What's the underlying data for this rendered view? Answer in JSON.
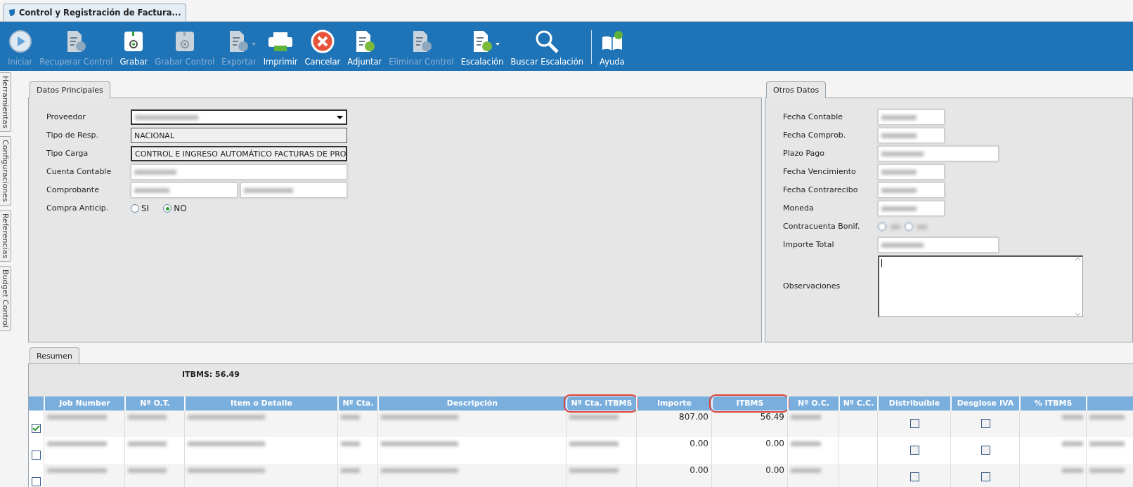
{
  "window": {
    "title": "Control y Registración de Factura..."
  },
  "toolbar": [
    {
      "label": "Iniciar",
      "kind": "play",
      "disabled": true,
      "dropdown": false
    },
    {
      "label": "Recuperar Control",
      "kind": "document",
      "disabled": true,
      "dropdown": false
    },
    {
      "label": "Grabar",
      "kind": "floppy",
      "disabled": false,
      "dropdown": false
    },
    {
      "label": "Grabar Control",
      "kind": "floppy",
      "disabled": true,
      "dropdown": false
    },
    {
      "label": "Exportar",
      "kind": "document",
      "disabled": true,
      "dropdown": true
    },
    {
      "label": "Imprimir",
      "kind": "printer",
      "disabled": false,
      "dropdown": false
    },
    {
      "label": "Cancelar",
      "kind": "cancel",
      "disabled": false,
      "dropdown": false
    },
    {
      "label": "Adjuntar",
      "kind": "attach",
      "disabled": false,
      "dropdown": false
    },
    {
      "label": "Eliminar Control",
      "kind": "document",
      "disabled": true,
      "dropdown": false
    },
    {
      "label": "Escalación",
      "kind": "attach",
      "disabled": false,
      "dropdown": true
    },
    {
      "label": "Buscar Escalación",
      "kind": "search",
      "disabled": false,
      "dropdown": false
    },
    {
      "label": "Ayuda",
      "kind": "book",
      "disabled": false,
      "dropdown": false
    }
  ],
  "side_tabs": [
    {
      "label": "Herramientas"
    },
    {
      "label": "Configuraciones"
    },
    {
      "label": "Referencias"
    },
    {
      "label": "Budget Control"
    }
  ],
  "datos_principales": {
    "title": "Datos Principales",
    "fields": [
      {
        "label": "Proveedor",
        "kind": "select"
      },
      {
        "label": "Tipo de Resp.",
        "kind": "text",
        "value": "NACIONAL"
      },
      {
        "label": "Tipo Carga",
        "kind": "select",
        "value": "CONTROL E INGRESO AUTOMÁTICO FACTURAS DE PRO"
      },
      {
        "label": "Cuenta Contable",
        "kind": "redacted"
      },
      {
        "label": "Comprobante",
        "kind": "split"
      },
      {
        "label": "Compra Anticip.",
        "kind": "radio",
        "options": [
          {
            "label": "SI",
            "selected": false
          },
          {
            "label": "NO",
            "selected": true
          }
        ]
      }
    ]
  },
  "otros_datos": {
    "title": "Otros Datos",
    "fields": [
      {
        "label": "Fecha Contable",
        "kind": "date"
      },
      {
        "label": "Fecha Comprob.",
        "kind": "date"
      },
      {
        "label": "Plazo Pago",
        "kind": "wide"
      },
      {
        "label": "Fecha Vencimiento",
        "kind": "date"
      },
      {
        "label": "Fecha Contrarecibo",
        "kind": "date"
      },
      {
        "label": "Moneda",
        "kind": "date"
      },
      {
        "label": "Contracuenta Bonif.",
        "kind": "radio-redacted"
      },
      {
        "label": "Importe Total",
        "kind": "wide"
      },
      {
        "label": "Observaciones",
        "kind": "textarea"
      }
    ]
  },
  "resumen": {
    "title": "Resumen",
    "summary": "ITBMS: 56.49",
    "columns": [
      {
        "label": "Job Number",
        "highlighted": false
      },
      {
        "label": "Nº O.T.",
        "highlighted": false
      },
      {
        "label": "Item o Detalle",
        "highlighted": false
      },
      {
        "label": "Nº Cta.",
        "highlighted": false
      },
      {
        "label": "Descripción",
        "highlighted": false
      },
      {
        "label": "Nº Cta. ITBMS",
        "highlighted": true
      },
      {
        "label": "Importe",
        "highlighted": false
      },
      {
        "label": "ITBMS",
        "highlighted": true
      },
      {
        "label": "Nº O.C.",
        "highlighted": false
      },
      {
        "label": "Nº C.C.",
        "highlighted": false
      },
      {
        "label": "Distribuíble",
        "highlighted": false
      },
      {
        "label": "Desglose IVA",
        "highlighted": false
      },
      {
        "label": "% ITBMS",
        "highlighted": false
      }
    ],
    "rows": [
      {
        "checked": true,
        "importe": "807.00",
        "itbms": "56.49",
        "distribuible": false,
        "desglose_iva": false
      },
      {
        "checked": false,
        "importe": "0.00",
        "itbms": "0.00",
        "distribuible": false,
        "desglose_iva": false
      },
      {
        "checked": false,
        "importe": "0.00",
        "itbms": "0.00",
        "distribuible": false,
        "desglose_iva": false
      }
    ]
  }
}
